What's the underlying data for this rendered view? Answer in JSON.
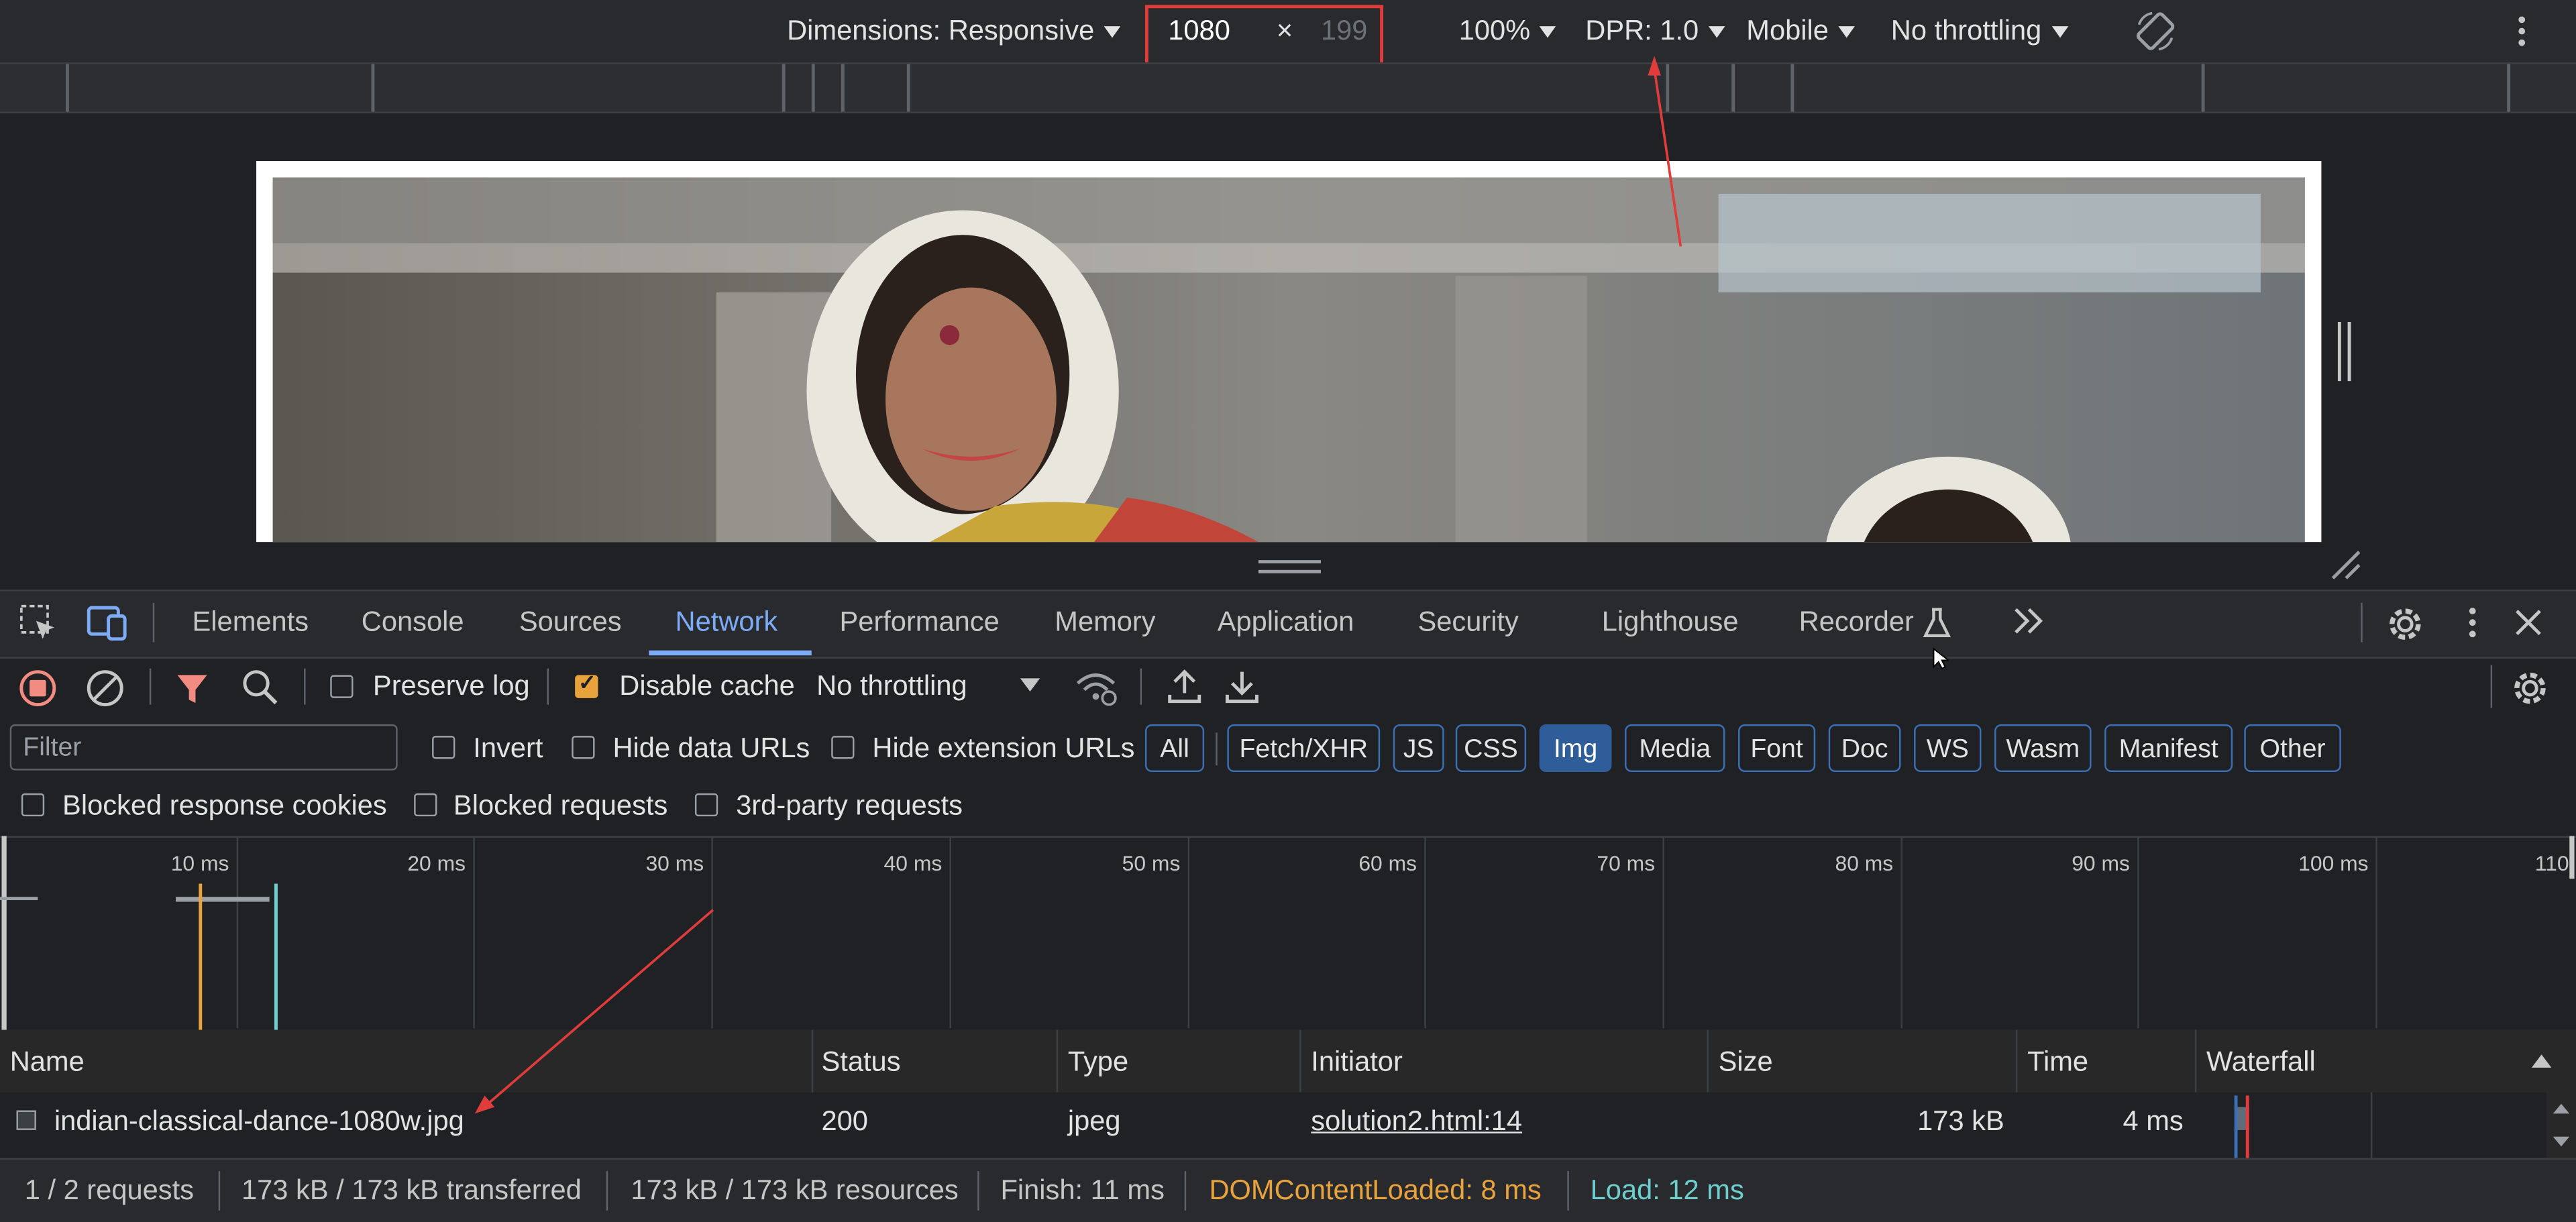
{
  "device_toolbar": {
    "dimensions_label": "Dimensions: Responsive",
    "width_value": "1080",
    "times_symbol": "×",
    "height_placeholder": "199",
    "zoom": "100%",
    "dpr": "DPR: 1.0",
    "device_type": "Mobile",
    "throttling": "No throttling"
  },
  "devtools_tabs": [
    "Elements",
    "Console",
    "Sources",
    "Network",
    "Performance",
    "Memory",
    "Application",
    "Security",
    "Lighthouse",
    "Recorder"
  ],
  "active_tab": "Network",
  "network_toolbar": {
    "preserve_log": "Preserve log",
    "disable_cache": "Disable cache",
    "throttling": "No throttling"
  },
  "filter_bar": {
    "filter_placeholder": "Filter",
    "invert": "Invert",
    "hide_data_urls": "Hide data URLs",
    "hide_extension_urls": "Hide extension URLs",
    "types": [
      "All",
      "Fetch/XHR",
      "JS",
      "CSS",
      "Img",
      "Media",
      "Font",
      "Doc",
      "WS",
      "Wasm",
      "Manifest",
      "Other"
    ],
    "active_type": "Img"
  },
  "filter_bar2": {
    "blocked_cookies": "Blocked response cookies",
    "blocked_requests": "Blocked requests",
    "third_party": "3rd-party requests"
  },
  "timeline_ticks": [
    "10 ms",
    "20 ms",
    "30 ms",
    "40 ms",
    "50 ms",
    "60 ms",
    "70 ms",
    "80 ms",
    "90 ms",
    "100 ms",
    "110"
  ],
  "table": {
    "columns": [
      "Name",
      "Status",
      "Type",
      "Initiator",
      "Size",
      "Time",
      "Waterfall"
    ],
    "rows": [
      {
        "name": "indian-classical-dance-1080w.jpg",
        "status": "200",
        "type": "jpeg",
        "initiator": "solution2.html:14",
        "size": "173 kB",
        "time": "4 ms"
      }
    ]
  },
  "status_bar": {
    "requests": "1 / 2 requests",
    "transferred": "173 kB / 173 kB transferred",
    "resources": "173 kB / 173 kB resources",
    "finish": "Finish: 11 ms",
    "dom_content_loaded": "DOMContentLoaded: 8 ms",
    "load": "Load: 12 ms"
  },
  "colors": {
    "accent_blue": "#7cacf8",
    "dcl_orange": "#e8a33d",
    "load_teal": "#6fcfcf",
    "annotation_red": "#e03c3c"
  }
}
